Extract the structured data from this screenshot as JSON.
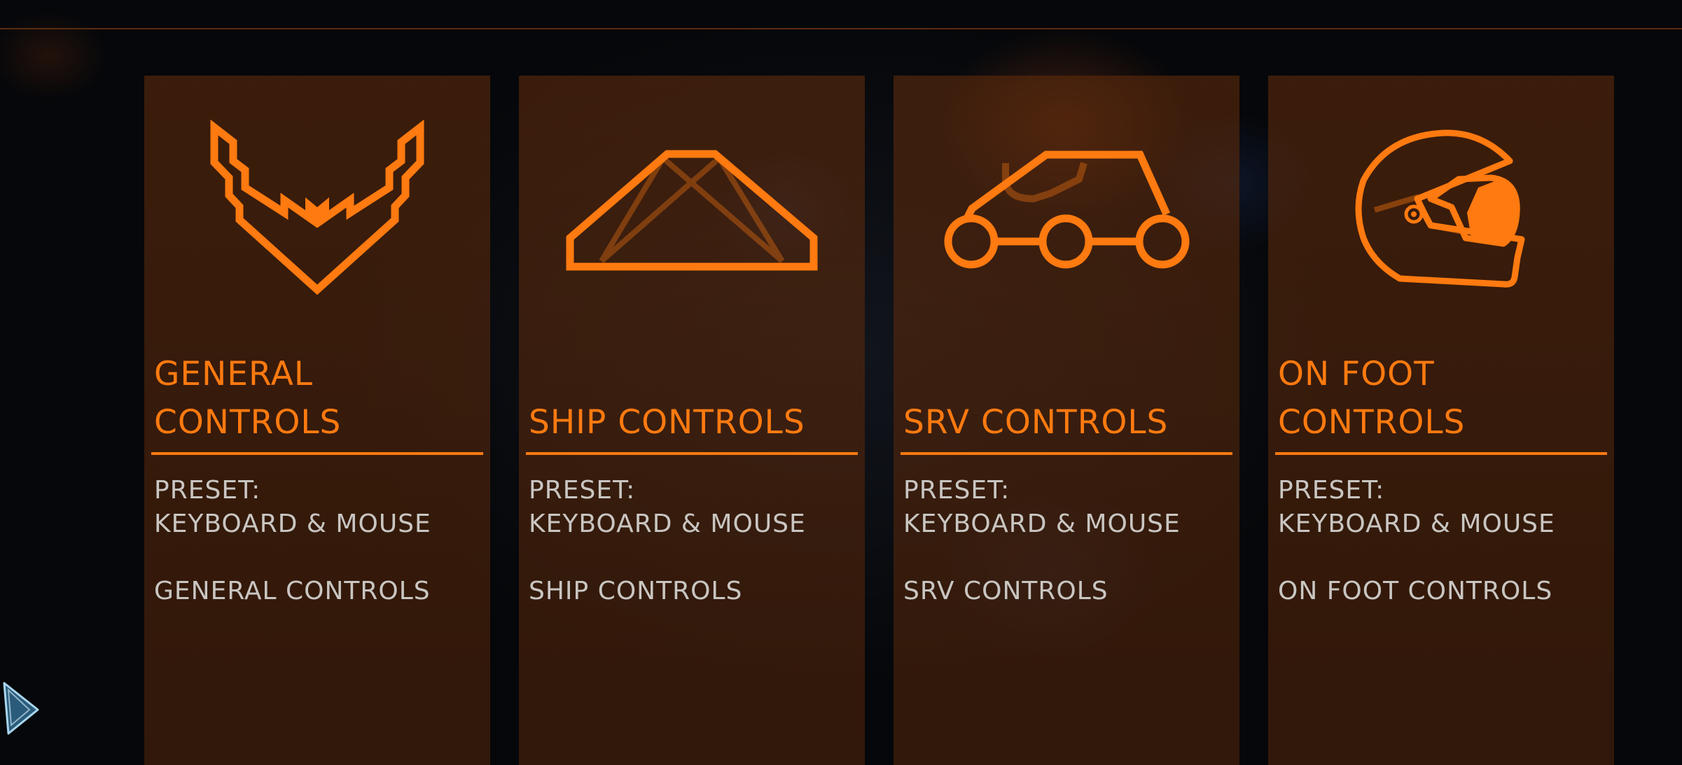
{
  "colors": {
    "accent": "#ff7a10",
    "card_bg": "#3a1c08",
    "text": "#c9c6c2"
  },
  "cards": [
    {
      "icon": "general-controls-icon",
      "title": "GENERAL\nCONTROLS",
      "preset_label": "PRESET:",
      "preset_value": "KEYBOARD & MOUSE",
      "section_label": "GENERAL CONTROLS"
    },
    {
      "icon": "ship-icon",
      "title": "SHIP CONTROLS",
      "preset_label": "PRESET:",
      "preset_value": "KEYBOARD & MOUSE",
      "section_label": "SHIP CONTROLS"
    },
    {
      "icon": "srv-buggy-icon",
      "title": "SRV CONTROLS",
      "preset_label": "PRESET:",
      "preset_value": "KEYBOARD & MOUSE",
      "section_label": "SRV CONTROLS"
    },
    {
      "icon": "helmet-icon",
      "title": "ON FOOT\nCONTROLS",
      "preset_label": "PRESET:",
      "preset_value": "KEYBOARD & MOUSE",
      "section_label": "ON FOOT CONTROLS"
    }
  ],
  "cursor": {
    "icon": "mouse-pointer-icon"
  }
}
